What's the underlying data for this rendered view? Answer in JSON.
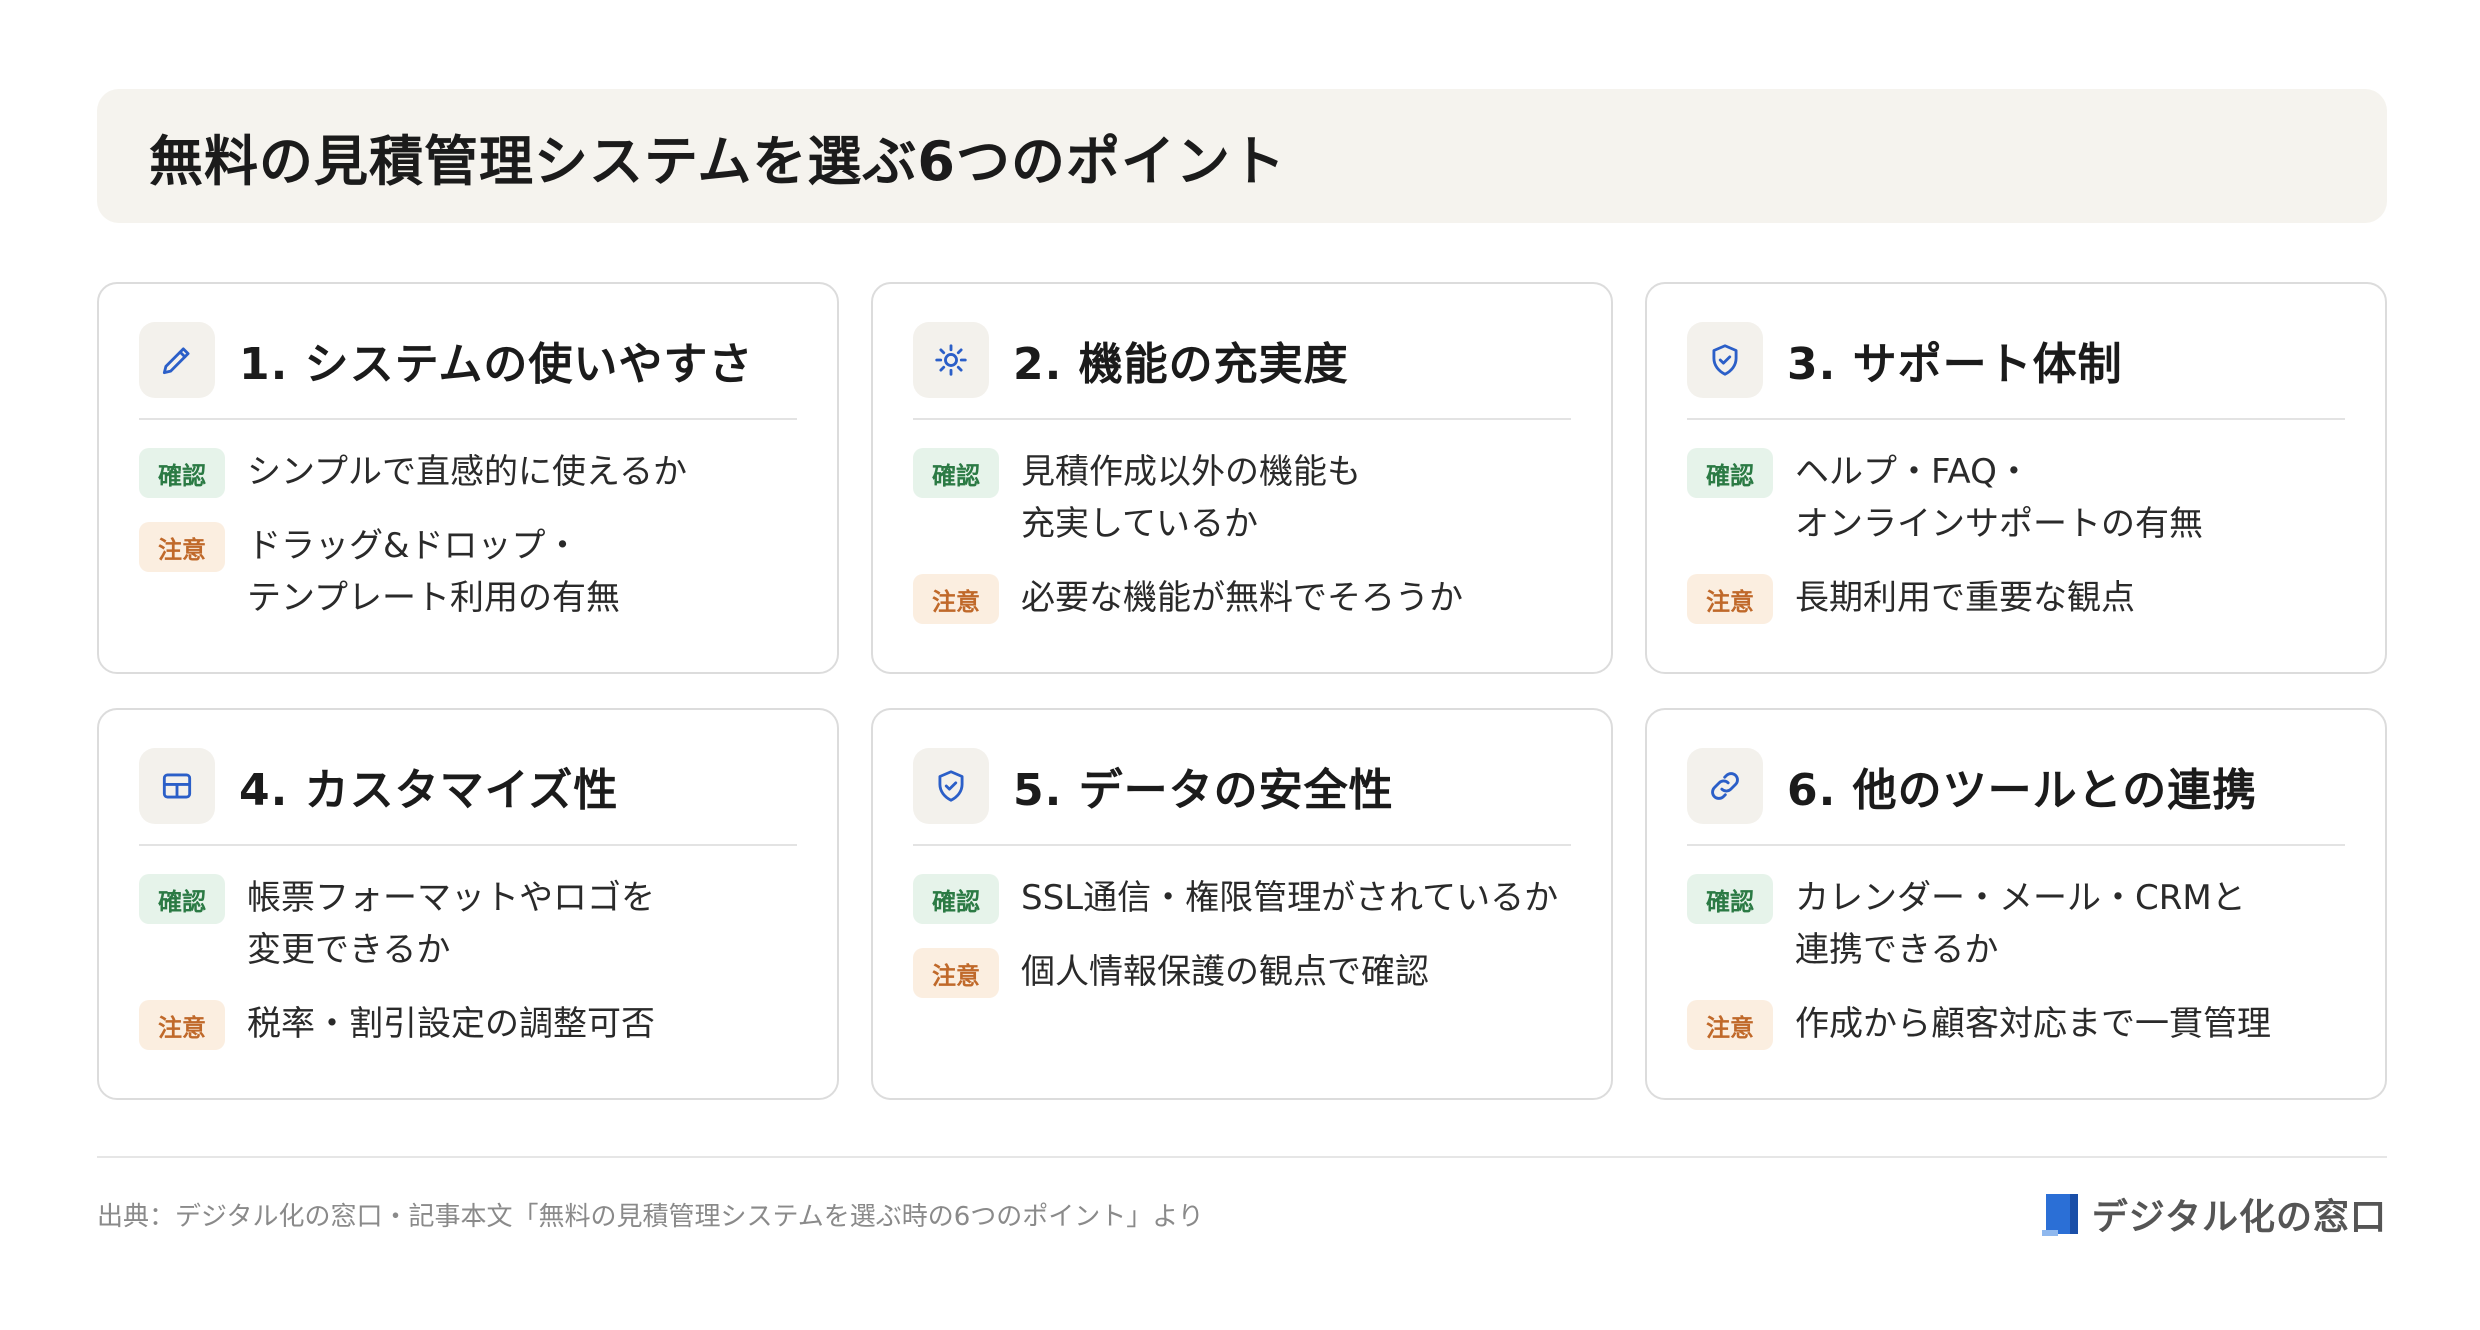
{
  "title": "無料の見積管理システムを選ぶ6つのポイント",
  "badges": {
    "ok": "確認",
    "warn": "注意"
  },
  "colors": {
    "accent_blue": "#2b5fc8",
    "ok_green": "#2b7a44",
    "warn_orange": "#c0692a",
    "title_bg": "#f5f3ee"
  },
  "cards": [
    {
      "icon": "pencil-icon",
      "title": "1. システムの使いやすさ",
      "check": "シンプルで直感的に使えるか",
      "note": "ドラッグ&ドロップ・\nテンプレート利用の有無"
    },
    {
      "icon": "gear-icon",
      "title": "2. 機能の充実度",
      "check": "見積作成以外の機能も\n充実しているか",
      "note": "必要な機能が無料でそろうか"
    },
    {
      "icon": "shield-check-icon",
      "title": "3. サポート体制",
      "check": "ヘルプ・FAQ・\nオンラインサポートの有無",
      "note": "長期利用で重要な観点"
    },
    {
      "icon": "layout-icon",
      "title": "4. カスタマイズ性",
      "check": "帳票フォーマットやロゴを\n変更できるか",
      "note": "税率・割引設定の調整可否"
    },
    {
      "icon": "shield-check-icon",
      "title": "5. データの安全性",
      "check": "SSL通信・権限管理がされているか",
      "note": "個人情報保護の観点で確認"
    },
    {
      "icon": "link-icon",
      "title": "6. 他のツールとの連携",
      "check": "カレンダー・メール・CRMと\n連携できるか",
      "note": "作成から顧客対応まで一貫管理"
    }
  ],
  "footer": {
    "source": "出典：デジタル化の窓口・記事本文「無料の見積管理システムを選ぶ時の6つのポイント」より",
    "brand": "デジタル化の窓口"
  }
}
